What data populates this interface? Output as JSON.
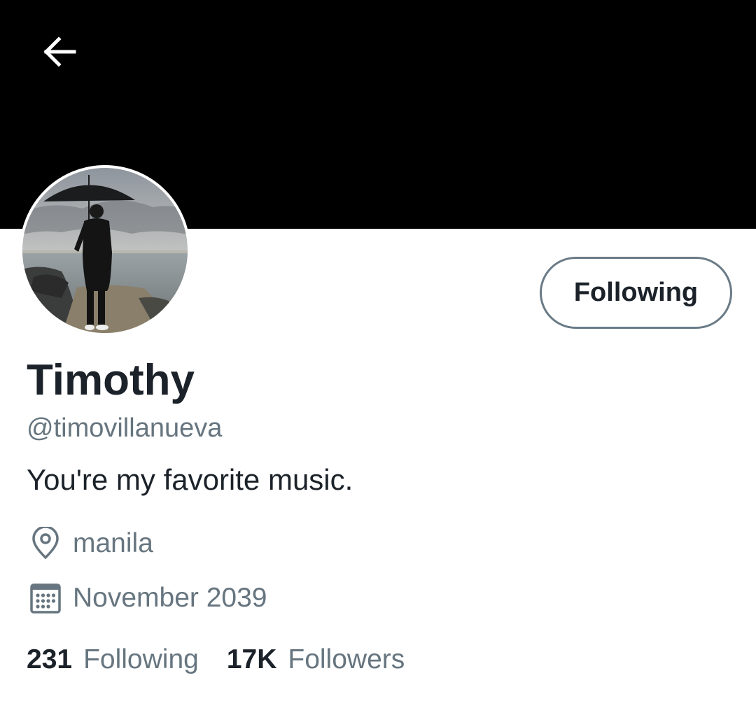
{
  "header": {
    "back_icon": "arrow-left-icon",
    "banner_color": "#000000"
  },
  "profile": {
    "avatar_alt": "profile photo",
    "display_name": "Timothy",
    "handle": "@timovillanueva",
    "bio": "You're my favorite music.",
    "follow_button_label": "Following",
    "location": "manila",
    "location_icon": "location-pin-icon",
    "joined": "November 2039",
    "joined_icon": "calendar-icon"
  },
  "stats": {
    "following_count": "231",
    "following_label": "Following",
    "followers_count": "17K",
    "followers_label": "Followers"
  },
  "colors": {
    "text_primary": "#1c2229",
    "text_secondary": "#66757f",
    "button_border": "#6a7b87"
  }
}
